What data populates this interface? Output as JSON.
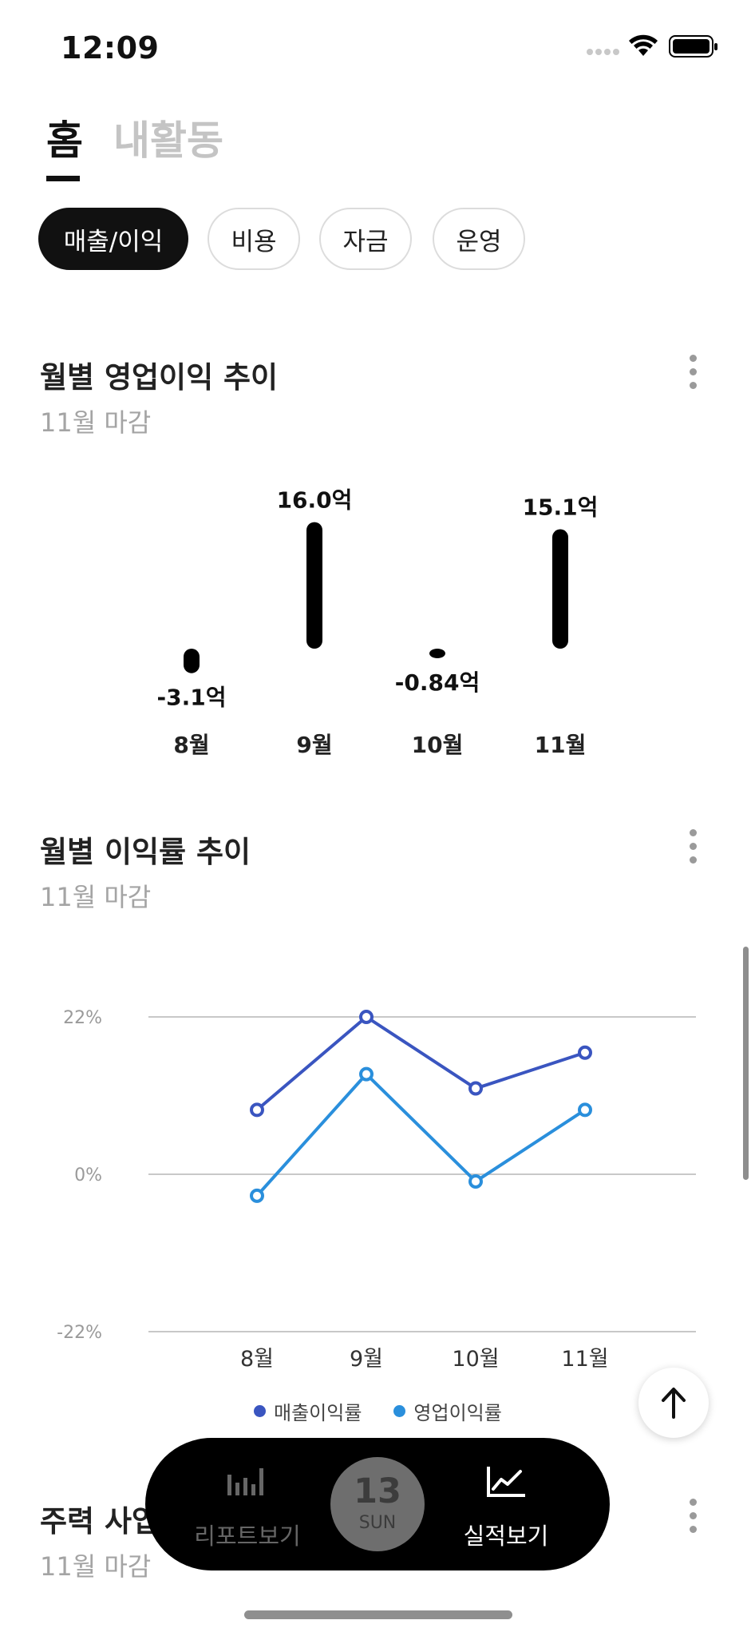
{
  "status_bar": {
    "time": "12:09",
    "signal_icon": "cellular-signal-dots",
    "wifi_icon": "wifi-icon",
    "battery_icon": "battery-full-icon"
  },
  "top_tabs": [
    {
      "label": "홈",
      "active": true
    },
    {
      "label": "내활동",
      "active": false
    }
  ],
  "chips": [
    {
      "label": "매출/이익",
      "active": true
    },
    {
      "label": "비용",
      "active": false
    },
    {
      "label": "자금",
      "active": false
    },
    {
      "label": "운영",
      "active": false
    }
  ],
  "sections": {
    "operating_profit": {
      "title": "월별 영업이익 추이",
      "subtitle": "11월 마감"
    },
    "profit_rate": {
      "title": "월별 이익률 추이",
      "subtitle": "11월 마감"
    },
    "main_business": {
      "title": "주력 사업",
      "subtitle": "11월 마감"
    }
  },
  "chart_data": [
    {
      "type": "bar",
      "categories": [
        "8월",
        "9월",
        "10월",
        "11월"
      ],
      "values": [
        -3.1,
        16.0,
        -0.84,
        15.1
      ],
      "value_labels": [
        "-3.1억",
        "16.0억",
        "-0.84억",
        "15.1억"
      ],
      "unit": "억",
      "bar_color": "#000000"
    },
    {
      "type": "line",
      "categories": [
        "8월",
        "9월",
        "10월",
        "11월"
      ],
      "yticks": [
        "22%",
        "0%",
        "-22%"
      ],
      "ylim": [
        -22,
        22
      ],
      "series": [
        {
          "name": "매출이익률",
          "values": [
            9,
            22,
            12,
            17
          ],
          "color": "#3a55c0"
        },
        {
          "name": "영업이익률",
          "values": [
            -3,
            14,
            -1,
            9
          ],
          "color": "#2a8fdc"
        }
      ],
      "grid": true,
      "legend_position": "bottom"
    }
  ],
  "scroll_top_icon": "arrow-up-icon",
  "bottom_nav": {
    "report_label": "리포트보기",
    "report_icon": "bar-chart-icon",
    "date_day": "13",
    "date_dow": "SUN",
    "perf_label": "실적보기",
    "perf_icon": "line-chart-icon"
  }
}
